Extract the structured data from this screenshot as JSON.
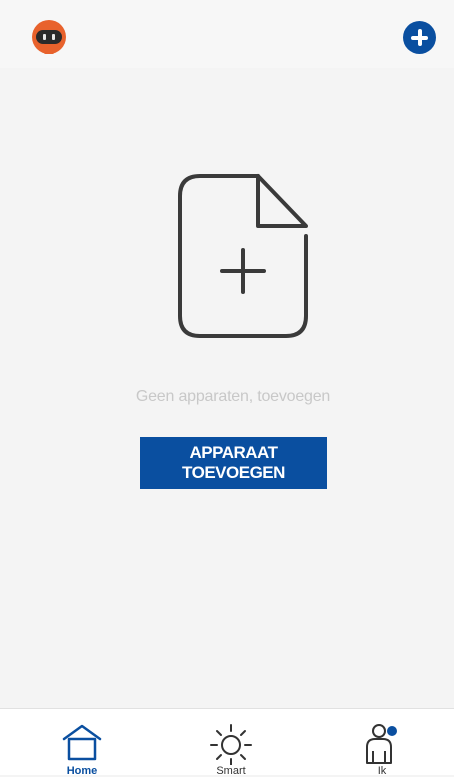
{
  "header": {
    "avatar_icon": "robot-avatar-icon",
    "add_icon": "plus-circle-icon"
  },
  "empty_state": {
    "icon": "add-document-icon",
    "message": "Geen apparaten, toevoegen",
    "button_label": "APPARAAT TOEVOEGEN"
  },
  "bottom_nav": {
    "items": [
      {
        "label": "Home",
        "icon": "home-icon",
        "active": true
      },
      {
        "label": "Smart",
        "icon": "sun-icon",
        "active": false
      },
      {
        "label": "Ik",
        "icon": "person-icon",
        "active": false
      }
    ]
  },
  "colors": {
    "accent": "#0a4fa0",
    "avatar": "#e8622c",
    "background": "#f4f4f4",
    "muted_text": "#c8c8c8"
  }
}
